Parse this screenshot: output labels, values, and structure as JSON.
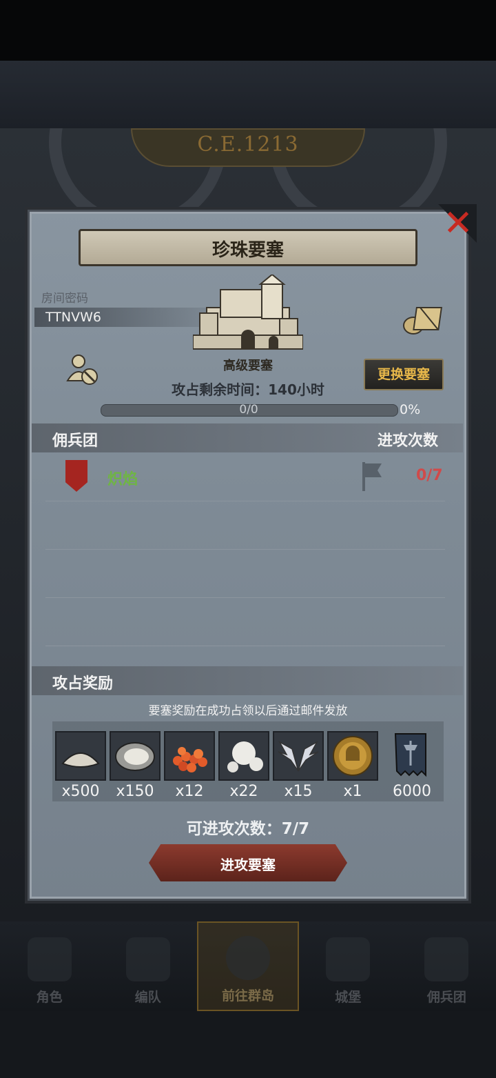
{
  "background": {
    "year_label": "C.E.1213"
  },
  "modal": {
    "title": "珍珠要塞",
    "room_code_label": "房间密码",
    "room_code": "TTNVW6",
    "fortress_level": "高级要塞",
    "change_fortress_label": "更换要塞",
    "remaining_time": "攻占剩余时间：140小时",
    "progress_text": "0/0",
    "progress_percent": "0%",
    "progress_fraction": 0,
    "mercenary_header": "佣兵团",
    "attack_count_header": "进攻次数",
    "mercenaries": [
      {
        "name": "炽焰",
        "attack_count": "0/7"
      }
    ],
    "reward_header": "攻占奖励",
    "reward_note": "要塞奖励在成功占领以后通过邮件发放",
    "rewards": [
      {
        "icon": "salt-pile-icon",
        "qty": "x500"
      },
      {
        "icon": "oyster-icon",
        "qty": "x150"
      },
      {
        "icon": "fish-roe-icon",
        "qty": "x12"
      },
      {
        "icon": "pearl-icon",
        "qty": "x22"
      },
      {
        "icon": "wing-emblem-icon",
        "qty": "x15"
      },
      {
        "icon": "knight-coin-icon",
        "qty": "x1"
      },
      {
        "icon": "banner-axe-icon",
        "qty": "6000"
      }
    ],
    "attack_remaining": "可进攻次数：7/7",
    "attack_button_label": "进攻要塞"
  },
  "bottom_nav": {
    "items": [
      {
        "label": "角色",
        "icon": "character-icon"
      },
      {
        "label": "编队",
        "icon": "formation-icon"
      },
      {
        "label": "前往群岛",
        "icon": "islands-icon"
      },
      {
        "label": "城堡",
        "icon": "castle-icon"
      },
      {
        "label": "佣兵团",
        "icon": "mercenary-icon"
      }
    ],
    "active_index": 2
  },
  "colors": {
    "accent_gold": "#e8b84a",
    "merc_name_green": "#6fb544",
    "count_red": "#d04a4a",
    "close_red": "#c72a22"
  }
}
